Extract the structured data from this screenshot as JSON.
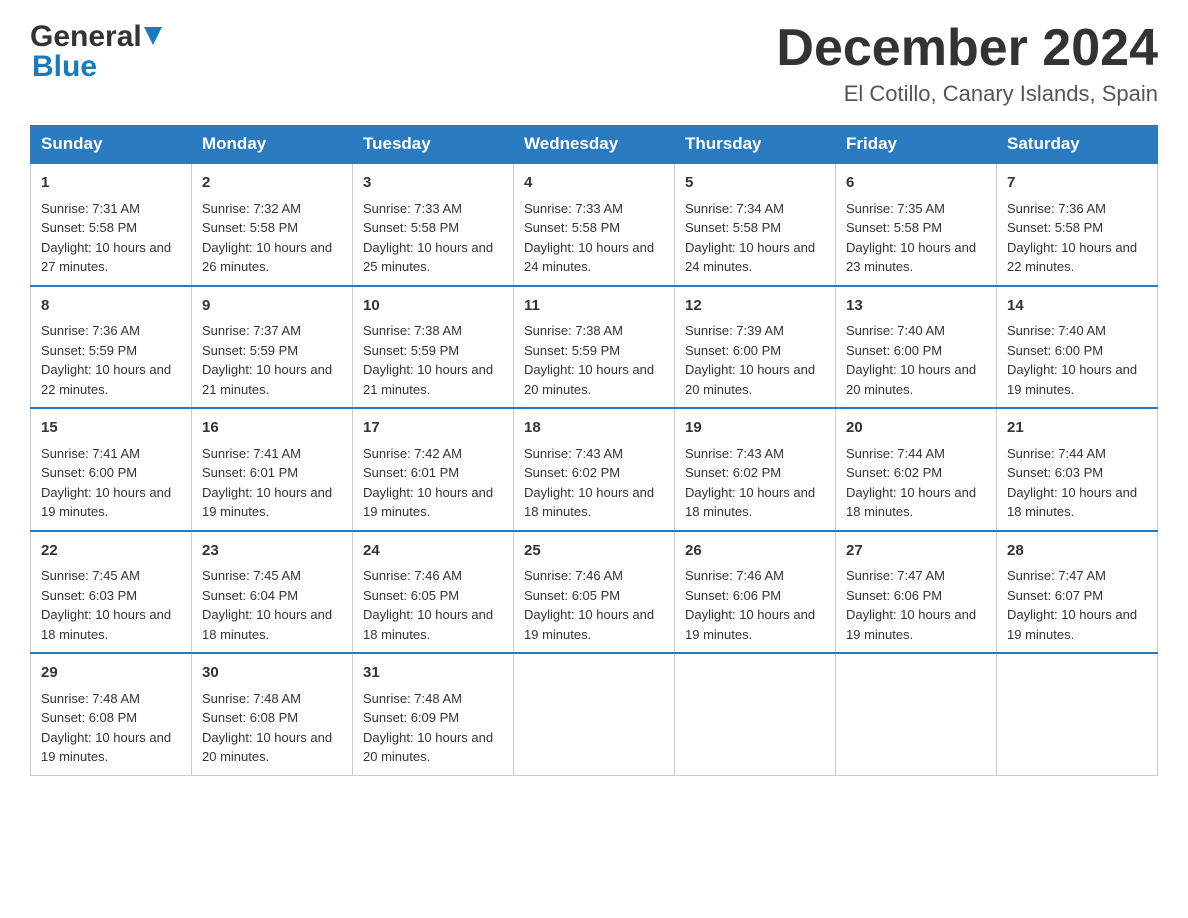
{
  "header": {
    "logo_general": "General",
    "logo_blue": "Blue",
    "title": "December 2024",
    "subtitle": "El Cotillo, Canary Islands, Spain"
  },
  "weekdays": [
    "Sunday",
    "Monday",
    "Tuesday",
    "Wednesday",
    "Thursday",
    "Friday",
    "Saturday"
  ],
  "weeks": [
    [
      {
        "day": "1",
        "sunrise": "7:31 AM",
        "sunset": "5:58 PM",
        "daylight": "10 hours and 27 minutes."
      },
      {
        "day": "2",
        "sunrise": "7:32 AM",
        "sunset": "5:58 PM",
        "daylight": "10 hours and 26 minutes."
      },
      {
        "day": "3",
        "sunrise": "7:33 AM",
        "sunset": "5:58 PM",
        "daylight": "10 hours and 25 minutes."
      },
      {
        "day": "4",
        "sunrise": "7:33 AM",
        "sunset": "5:58 PM",
        "daylight": "10 hours and 24 minutes."
      },
      {
        "day": "5",
        "sunrise": "7:34 AM",
        "sunset": "5:58 PM",
        "daylight": "10 hours and 24 minutes."
      },
      {
        "day": "6",
        "sunrise": "7:35 AM",
        "sunset": "5:58 PM",
        "daylight": "10 hours and 23 minutes."
      },
      {
        "day": "7",
        "sunrise": "7:36 AM",
        "sunset": "5:58 PM",
        "daylight": "10 hours and 22 minutes."
      }
    ],
    [
      {
        "day": "8",
        "sunrise": "7:36 AM",
        "sunset": "5:59 PM",
        "daylight": "10 hours and 22 minutes."
      },
      {
        "day": "9",
        "sunrise": "7:37 AM",
        "sunset": "5:59 PM",
        "daylight": "10 hours and 21 minutes."
      },
      {
        "day": "10",
        "sunrise": "7:38 AM",
        "sunset": "5:59 PM",
        "daylight": "10 hours and 21 minutes."
      },
      {
        "day": "11",
        "sunrise": "7:38 AM",
        "sunset": "5:59 PM",
        "daylight": "10 hours and 20 minutes."
      },
      {
        "day": "12",
        "sunrise": "7:39 AM",
        "sunset": "6:00 PM",
        "daylight": "10 hours and 20 minutes."
      },
      {
        "day": "13",
        "sunrise": "7:40 AM",
        "sunset": "6:00 PM",
        "daylight": "10 hours and 20 minutes."
      },
      {
        "day": "14",
        "sunrise": "7:40 AM",
        "sunset": "6:00 PM",
        "daylight": "10 hours and 19 minutes."
      }
    ],
    [
      {
        "day": "15",
        "sunrise": "7:41 AM",
        "sunset": "6:00 PM",
        "daylight": "10 hours and 19 minutes."
      },
      {
        "day": "16",
        "sunrise": "7:41 AM",
        "sunset": "6:01 PM",
        "daylight": "10 hours and 19 minutes."
      },
      {
        "day": "17",
        "sunrise": "7:42 AM",
        "sunset": "6:01 PM",
        "daylight": "10 hours and 19 minutes."
      },
      {
        "day": "18",
        "sunrise": "7:43 AM",
        "sunset": "6:02 PM",
        "daylight": "10 hours and 18 minutes."
      },
      {
        "day": "19",
        "sunrise": "7:43 AM",
        "sunset": "6:02 PM",
        "daylight": "10 hours and 18 minutes."
      },
      {
        "day": "20",
        "sunrise": "7:44 AM",
        "sunset": "6:02 PM",
        "daylight": "10 hours and 18 minutes."
      },
      {
        "day": "21",
        "sunrise": "7:44 AM",
        "sunset": "6:03 PM",
        "daylight": "10 hours and 18 minutes."
      }
    ],
    [
      {
        "day": "22",
        "sunrise": "7:45 AM",
        "sunset": "6:03 PM",
        "daylight": "10 hours and 18 minutes."
      },
      {
        "day": "23",
        "sunrise": "7:45 AM",
        "sunset": "6:04 PM",
        "daylight": "10 hours and 18 minutes."
      },
      {
        "day": "24",
        "sunrise": "7:46 AM",
        "sunset": "6:05 PM",
        "daylight": "10 hours and 18 minutes."
      },
      {
        "day": "25",
        "sunrise": "7:46 AM",
        "sunset": "6:05 PM",
        "daylight": "10 hours and 19 minutes."
      },
      {
        "day": "26",
        "sunrise": "7:46 AM",
        "sunset": "6:06 PM",
        "daylight": "10 hours and 19 minutes."
      },
      {
        "day": "27",
        "sunrise": "7:47 AM",
        "sunset": "6:06 PM",
        "daylight": "10 hours and 19 minutes."
      },
      {
        "day": "28",
        "sunrise": "7:47 AM",
        "sunset": "6:07 PM",
        "daylight": "10 hours and 19 minutes."
      }
    ],
    [
      {
        "day": "29",
        "sunrise": "7:48 AM",
        "sunset": "6:08 PM",
        "daylight": "10 hours and 19 minutes."
      },
      {
        "day": "30",
        "sunrise": "7:48 AM",
        "sunset": "6:08 PM",
        "daylight": "10 hours and 20 minutes."
      },
      {
        "day": "31",
        "sunrise": "7:48 AM",
        "sunset": "6:09 PM",
        "daylight": "10 hours and 20 minutes."
      },
      null,
      null,
      null,
      null
    ]
  ],
  "labels": {
    "sunrise": "Sunrise:",
    "sunset": "Sunset:",
    "daylight": "Daylight:"
  }
}
